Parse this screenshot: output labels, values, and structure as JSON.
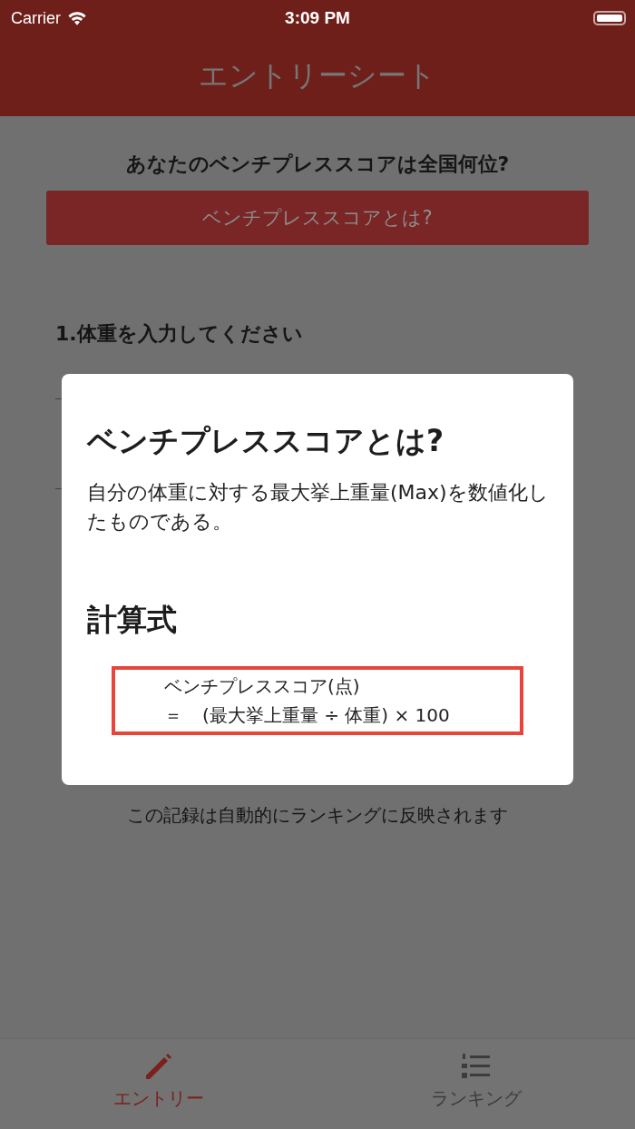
{
  "status_bar": {
    "carrier": "Carrier",
    "time": "3:09 PM"
  },
  "nav": {
    "title": "エントリーシート"
  },
  "main": {
    "heading": "あなたのベンチプレススコアは全国何位?",
    "info_button": "ベンチプレススコアとは?",
    "question_1": "1.体重を入力してください",
    "note": "この記録は自動的にランキングに反映されます"
  },
  "dialog": {
    "title": "ベンチプレススコアとは?",
    "description": "自分の体重に対する最大挙上重量(Max)を数値化したものである。",
    "formula_heading": "計算式",
    "formula_line_1": "ベンチプレススコア(点)",
    "formula_equals": "＝",
    "formula_line_2": "(最大挙上重量 ÷ 体重) × 100"
  },
  "tabs": [
    {
      "label": "エントリー",
      "kind": "pencil",
      "selected": true
    },
    {
      "label": "ランキング",
      "kind": "list",
      "selected": false
    }
  ]
}
